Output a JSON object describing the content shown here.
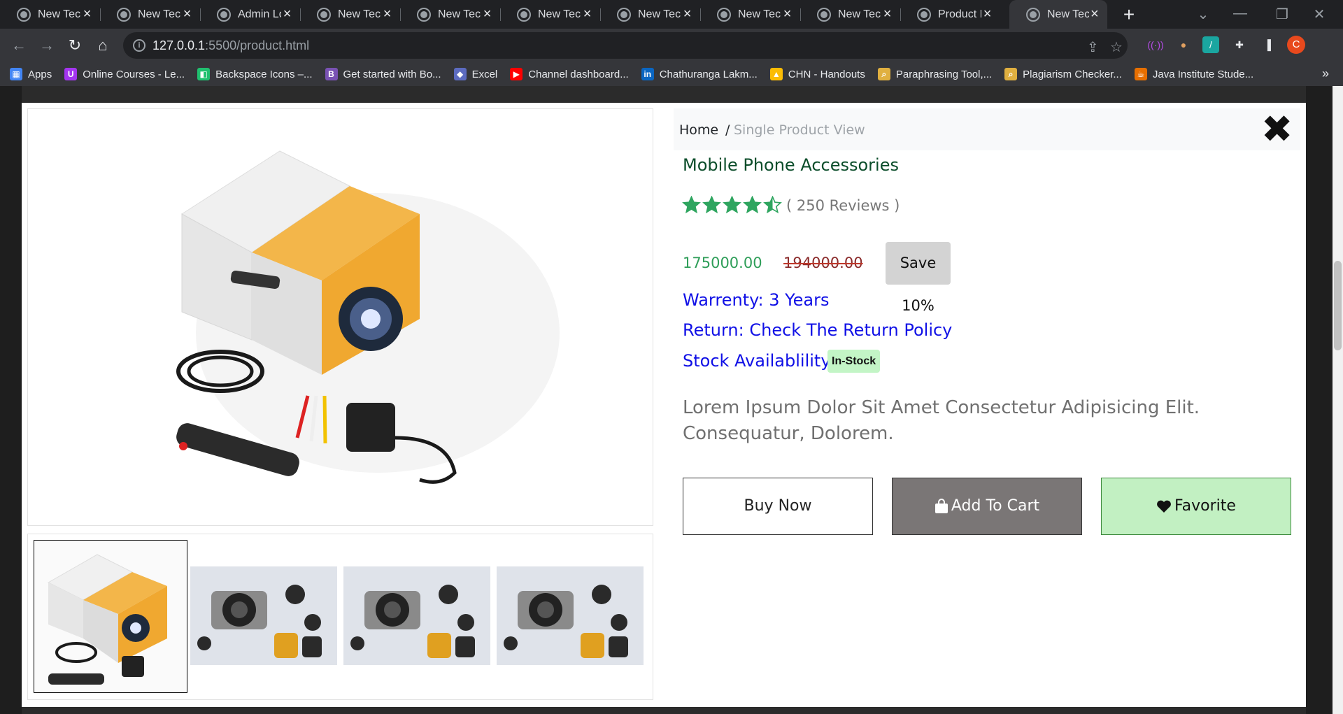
{
  "browser": {
    "tabs": [
      {
        "title": "New Tech"
      },
      {
        "title": "New Tech"
      },
      {
        "title": "Admin Lo"
      },
      {
        "title": "New Tech"
      },
      {
        "title": "New Tech"
      },
      {
        "title": "New Tech"
      },
      {
        "title": "New Tech"
      },
      {
        "title": "New Tech"
      },
      {
        "title": "New Tech"
      },
      {
        "title": "Product M"
      },
      {
        "title": "New Tech",
        "active": true
      }
    ],
    "new_tab": "+",
    "url_host": "127.0.0.1",
    "url_rest": ":5500/product.html",
    "profile_initial": "C",
    "bookmarks": [
      {
        "label": "Apps",
        "icon": "apps-grid-icon",
        "color": "#4285f4"
      },
      {
        "label": "Online Courses - Le...",
        "icon": "udemy-icon",
        "color": "#a435f0"
      },
      {
        "label": "Backspace Icons –...",
        "icon": "backspace-icon",
        "color": "#20c06f"
      },
      {
        "label": "Get started with Bo...",
        "icon": "bootstrap-icon",
        "color": "#7952b3"
      },
      {
        "label": "Excel",
        "icon": "excel-icon",
        "color": "#5c6bc0"
      },
      {
        "label": "Channel dashboard...",
        "icon": "youtube-icon",
        "color": "#ff0000"
      },
      {
        "label": "Chathuranga Lakm...",
        "icon": "linkedin-icon",
        "color": "#0a66c2"
      },
      {
        "label": "CHN - Handouts",
        "icon": "google-drive-icon",
        "color": "#fbbc04"
      },
      {
        "label": "Paraphrasing Tool,...",
        "icon": "magnifier-icon",
        "color": "#e0b040"
      },
      {
        "label": "Plagiarism Checker...",
        "icon": "magnifier-icon",
        "color": "#e0b040"
      },
      {
        "label": "Java Institute Stude...",
        "icon": "java-icon",
        "color": "#e76f00"
      }
    ],
    "bookmarks_more": "»"
  },
  "modal": {
    "breadcrumb": {
      "home": "Home",
      "separator": "/",
      "current": "Single Product View"
    },
    "category": "Mobile Phone Accessories",
    "rating": {
      "stars": 4.5,
      "reviews_text": "( 250 Reviews )"
    },
    "price": "175000.00",
    "old_price": "194000.00",
    "save_badge": "Save 10%",
    "warranty": "Warrenty: 3 Years",
    "return_policy": "Return: Check The Return Policy",
    "stock_label": "Stock Availablility:",
    "stock_badge": "In-Stock",
    "description": "Lorem Ipsum Dolor Sit Amet Consectetur Adipisicing Elit. Consequatur, Dolorem.",
    "buttons": {
      "buy_now": "Buy Now",
      "add_to_cart": "Add To Cart",
      "favorite": "Favorite"
    },
    "close_symbol": "✖"
  },
  "colors": {
    "category": "#0b4d2a",
    "price": "#2f9e59",
    "info_text": "#1010e6",
    "star": "#2ea55f",
    "favorite_button": "#c2f0c2",
    "cart_button": "#7a7676",
    "stock_badge": "#c3f5c6"
  }
}
